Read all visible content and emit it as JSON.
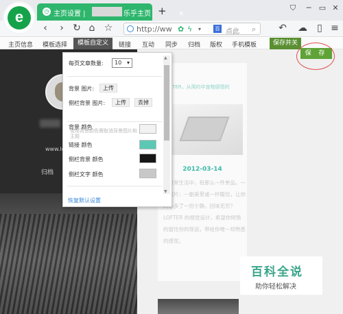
{
  "browser": {
    "tab_title": "主页设置 |",
    "tab_title_suffix": "乐乎主页",
    "tab_close": "✕",
    "new_tab": "+",
    "address": "http://ww",
    "search_placeholder": "点此",
    "window_controls": [
      "shirt-icon",
      "minimize-icon",
      "restore-icon",
      "close-icon"
    ]
  },
  "lofter_toolbar": {
    "items": [
      "主页信息",
      "模板选择",
      "模板自定义",
      "链接",
      "互动",
      "同步",
      "归档",
      "版权",
      "手机模板"
    ],
    "active": "模板自定义",
    "save_publish": "保存并关",
    "save": "保 存"
  },
  "left_panel": {
    "www_text": "www.lo",
    "nav_archive": "归档",
    "nav_other": "私"
  },
  "post": {
    "note": "LOFTER，从简约中宠物感悟的",
    "date": "2012-03-14",
    "body": "在日常生活中，有那么一件单品。一张照片：一副美景或一杯暖饮，让你的心多了一份宁静。回味无穷？LOFTER 的视觉设计，希望你倾情的留住你的现说，带给你唯一却熟悉的感觉。"
  },
  "popup": {
    "per_page_label": "每页文章数量:",
    "per_page_value": "10",
    "bg_image_label": "背景 图片:",
    "upload": "上传",
    "sidebar_bg_label": "侧栏背景 图片:",
    "sidebar_upload": "上传",
    "remove": "去掉",
    "bg_color_label": "背景 颜色",
    "overlap_note": "使用背景颜色需取消背景图片和主题",
    "link_color_label": "链接 颜色",
    "sidebar_bg_color_label": "侧栏背景 颜色",
    "sidebar_text_color_label": "侧栏文字 颜色",
    "reset": "恢复默认设置",
    "colors": {
      "background": "#f2f2f2",
      "link": "#5cc8b4",
      "sidebar_bg": "#161616",
      "sidebar_text": "#c8c8c8"
    }
  },
  "watermark": {
    "title": "百科全说",
    "subtitle": "助你轻松解决"
  }
}
